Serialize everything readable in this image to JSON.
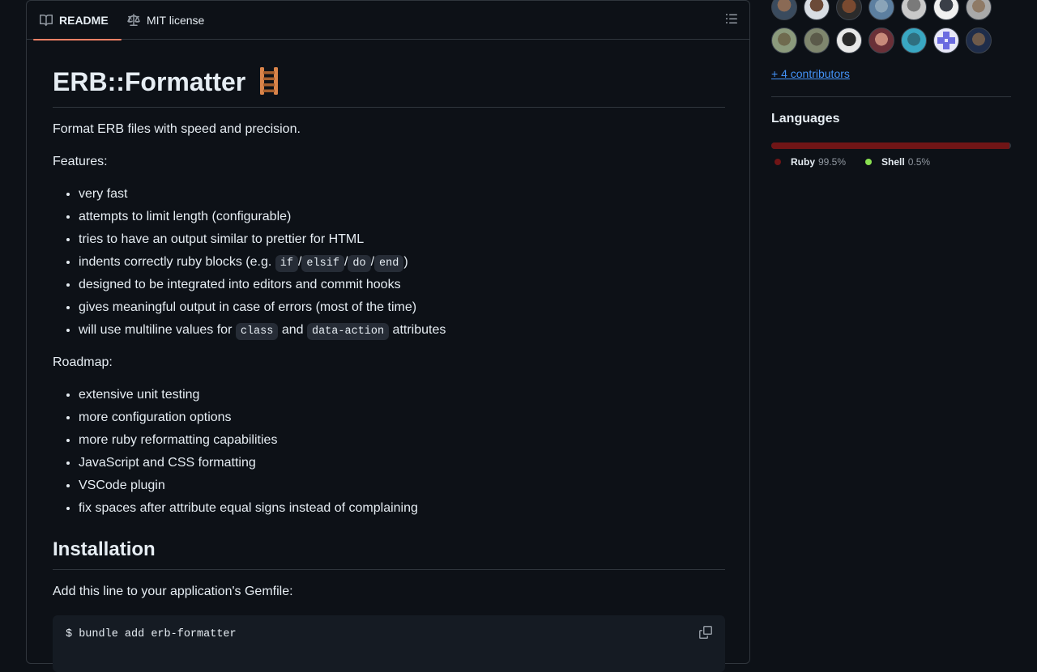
{
  "tabs": {
    "readme": "README",
    "license": "MIT license"
  },
  "readme": {
    "title": "ERB::Formatter",
    "title_emoji": "ladder",
    "description": "Format ERB files with speed and precision.",
    "features_label": "Features:",
    "features": [
      {
        "text": "very fast"
      },
      {
        "text": "attempts to limit length (configurable)"
      },
      {
        "text": "tries to have an output similar to prettier for HTML"
      },
      {
        "pre": "indents correctly ruby blocks (e.g. ",
        "codes": [
          "if",
          "elsif",
          "do",
          "end"
        ],
        "sep": "/",
        "post": ")"
      },
      {
        "text": "designed to be integrated into editors and commit hooks"
      },
      {
        "text": "gives meaningful output in case of errors (most of the time)"
      },
      {
        "pre": "will use multiline values for ",
        "code1": "class",
        "mid": " and ",
        "code2": "data-action",
        "post": " attributes"
      }
    ],
    "roadmap_label": "Roadmap:",
    "roadmap": [
      "extensive unit testing",
      "more configuration options",
      "more ruby reformatting capabilities",
      "JavaScript and CSS formatting",
      "VSCode plugin",
      "fix spaces after attribute equal signs instead of complaining"
    ],
    "installation_heading": "Installation",
    "gemfile_text": "Add this line to your application's Gemfile:",
    "code": "$ bundle add erb-formatter"
  },
  "sidebar": {
    "contributors_more": "+ 4 contributors",
    "languages_heading": "Languages",
    "languages": [
      {
        "name": "Ruby",
        "percent": "99.5%",
        "value": 99.5,
        "color": "#701516"
      },
      {
        "name": "Shell",
        "percent": "0.5%",
        "value": 0.5,
        "color": "#89e051"
      }
    ]
  },
  "icons": {
    "readme_tab": "book-icon",
    "license_tab": "law-icon",
    "outline": "list-unordered-icon",
    "copy": "copy-icon"
  },
  "colors": {
    "background": "#0d1117",
    "border": "#30363d",
    "link": "#4493f8",
    "tab_underline": "#f78166"
  }
}
